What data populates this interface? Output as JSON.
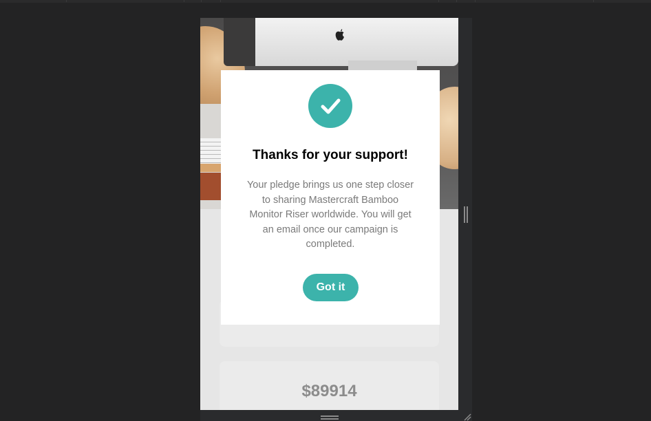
{
  "modal": {
    "icon": "check-icon",
    "title": "Thanks for your support!",
    "message": "Your pledge brings us one step closer to sharing Mastercraft Bamboo Monitor Riser worldwide. You will get an email once our campaign is completed.",
    "button_label": "Got it"
  },
  "stats": {
    "amount": "$89914"
  },
  "colors": {
    "accent": "#3cb3ab",
    "background": "#232324",
    "modal_bg": "#ffffff",
    "card_bg": "#ebebeb"
  }
}
